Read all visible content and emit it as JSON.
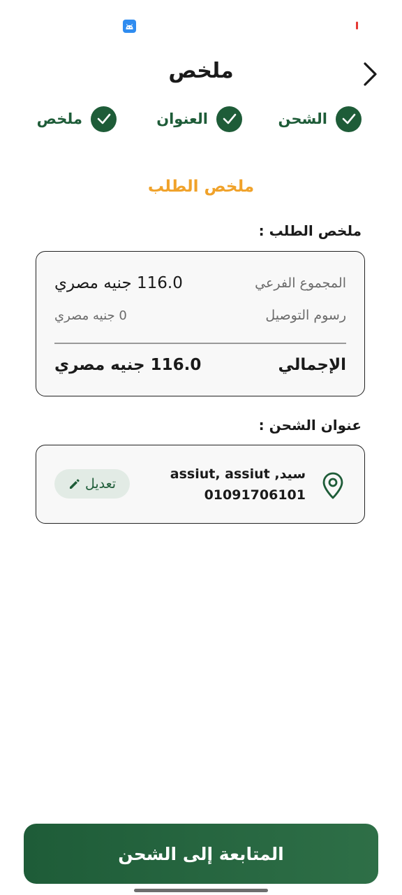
{
  "header": {
    "title": "ملخص"
  },
  "stepper": {
    "steps": [
      {
        "label": "الشحن"
      },
      {
        "label": "العنوان"
      },
      {
        "label": "ملخص"
      }
    ]
  },
  "order": {
    "heading": "ملخص الطلب",
    "section_label": "ملخص الطلب :",
    "subtotal_label": "المجموع الفرعي",
    "subtotal_value": "116.0 جنيه مصري",
    "delivery_label": "رسوم التوصيل",
    "delivery_value": "0 جنيه مصري",
    "total_label": "الإجمالي",
    "total_value": "116.0 جنيه مصري"
  },
  "shipping": {
    "section_label": "عنوان الشحن :",
    "address_line": "سيد, assiut, assiut",
    "phone": "01091706101",
    "edit_label": "تعديل"
  },
  "footer": {
    "continue_label": "المتابعة إلى الشحن"
  },
  "colors": {
    "brand_green": "#1e5c38",
    "accent_orange": "#f0a22a"
  }
}
